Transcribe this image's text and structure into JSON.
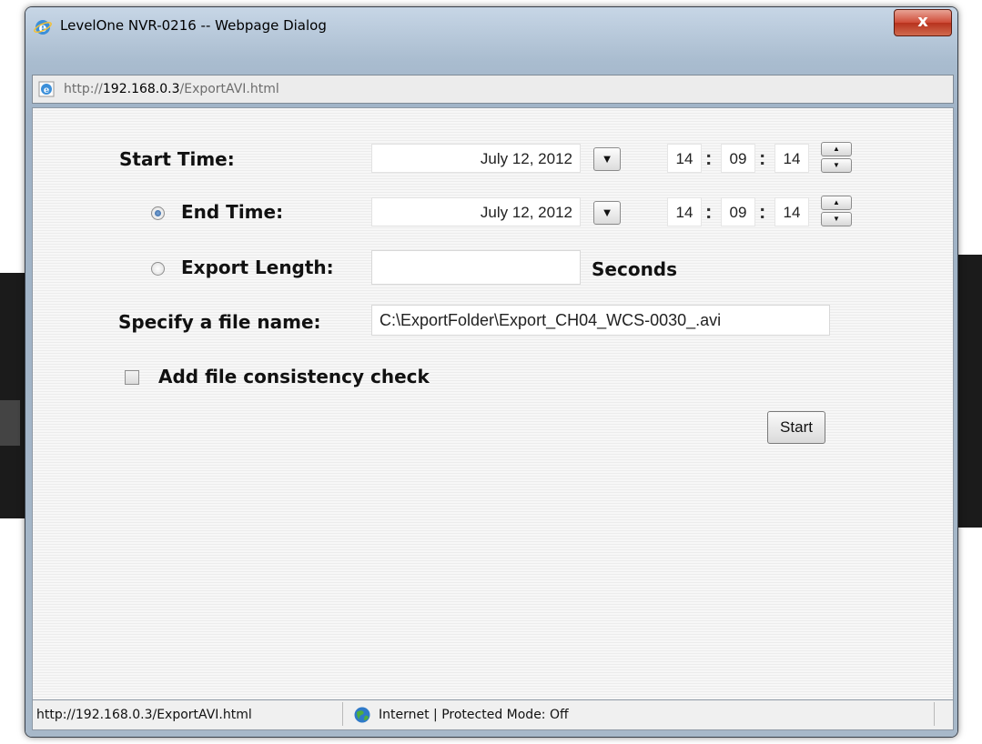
{
  "window": {
    "title": "LevelOne NVR-0216 -- Webpage Dialog",
    "close_label": "x"
  },
  "address": {
    "prefix": "http://",
    "host": "192.168.0.3",
    "path": "/ExportAVI.html"
  },
  "form": {
    "start_time_label": "Start Time:",
    "start_date": "July 12, 2012",
    "start_hour": "14",
    "start_minute": "09",
    "start_second": "14",
    "end_time_label": "End Time:",
    "end_date": "July 12, 2012",
    "end_hour": "14",
    "end_minute": "09",
    "end_second": "14",
    "export_length_label": "Export Length:",
    "export_length_value": "",
    "seconds_label": "Seconds",
    "file_name_label": "Specify a file name:",
    "file_name_value": "C:\\ExportFolder\\Export_CH04_WCS-0030_.avi",
    "consistency_label": "Add file consistency check",
    "start_button": "Start",
    "colon": ":"
  },
  "status": {
    "url": "http://192.168.0.3/ExportAVI.html",
    "zone": "Internet | Protected Mode: Off"
  }
}
